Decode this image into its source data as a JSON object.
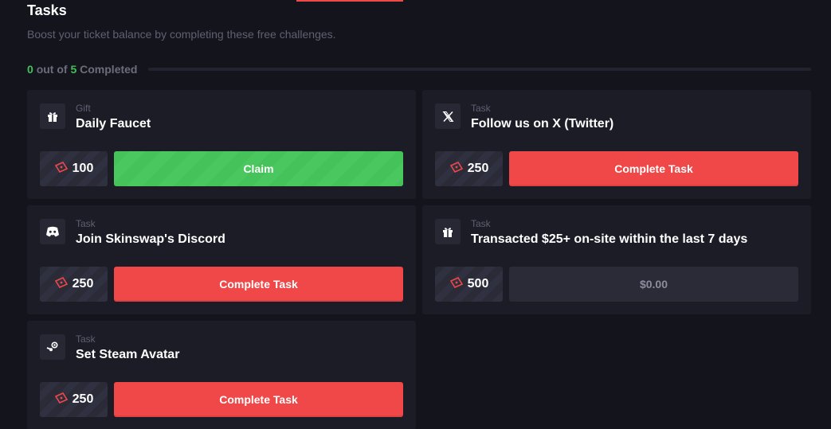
{
  "header": {
    "title": "Tasks",
    "subtitle": "Boost your ticket balance by completing these free challenges."
  },
  "progress": {
    "completed": "0",
    "out_of": "out of",
    "total": "5",
    "suffix": "Completed",
    "fraction": 0
  },
  "colors": {
    "accent_red": "#f04848",
    "accent_green": "#45c35a",
    "background": "#14141c",
    "card": "#1c1c27"
  },
  "tasks": [
    {
      "kind": "Gift",
      "title": "Daily Faucet",
      "reward": "100",
      "action": "Claim",
      "icon": "gift-icon"
    },
    {
      "kind": "Task",
      "title": "Follow us on X (Twitter)",
      "reward": "250",
      "action": "Complete Task",
      "icon": "x-twitter-icon"
    },
    {
      "kind": "Task",
      "title": "Join Skinswap's Discord",
      "reward": "250",
      "action": "Complete Task",
      "icon": "discord-icon"
    },
    {
      "kind": "Task",
      "title": "Transacted $25+ on-site within the last 7 days",
      "reward": "500",
      "action": "$0.00",
      "icon": "gift-icon"
    },
    {
      "kind": "Task",
      "title": "Set Steam Avatar",
      "reward": "250",
      "action": "Complete Task",
      "icon": "steam-icon"
    }
  ]
}
